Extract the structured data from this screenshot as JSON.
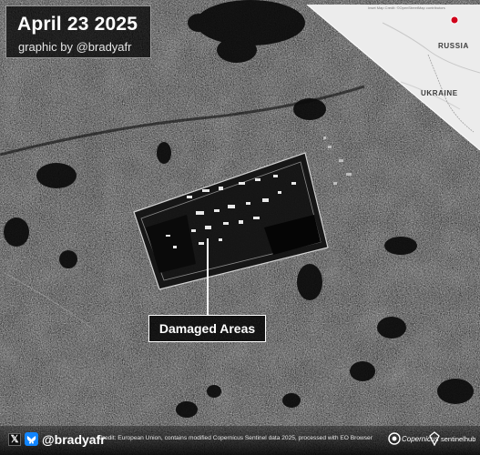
{
  "title": {
    "date": "April 23 2025",
    "credit": "graphic by @bradyafr"
  },
  "annotation": {
    "label": "Damaged Areas"
  },
  "inset_map": {
    "country_north": "RUSSIA",
    "country_south": "UKRAINE",
    "attribution": "Inset Map Credit: ©OpenStreetMap contributors",
    "marker_color": "#d0021b"
  },
  "footer": {
    "handle": "@bradyafr",
    "data_credit": "Credit: European Union, contains modified Copernicus Sentinel data 2025, processed with EO Browser",
    "logo_copernicus": "Copernicus",
    "logo_sentinelhub": "sentinelhub"
  },
  "colors": {
    "radar_base": "#3a3a3a",
    "inset_land": "#ececec",
    "bluesky_blue": "#1185fe"
  }
}
